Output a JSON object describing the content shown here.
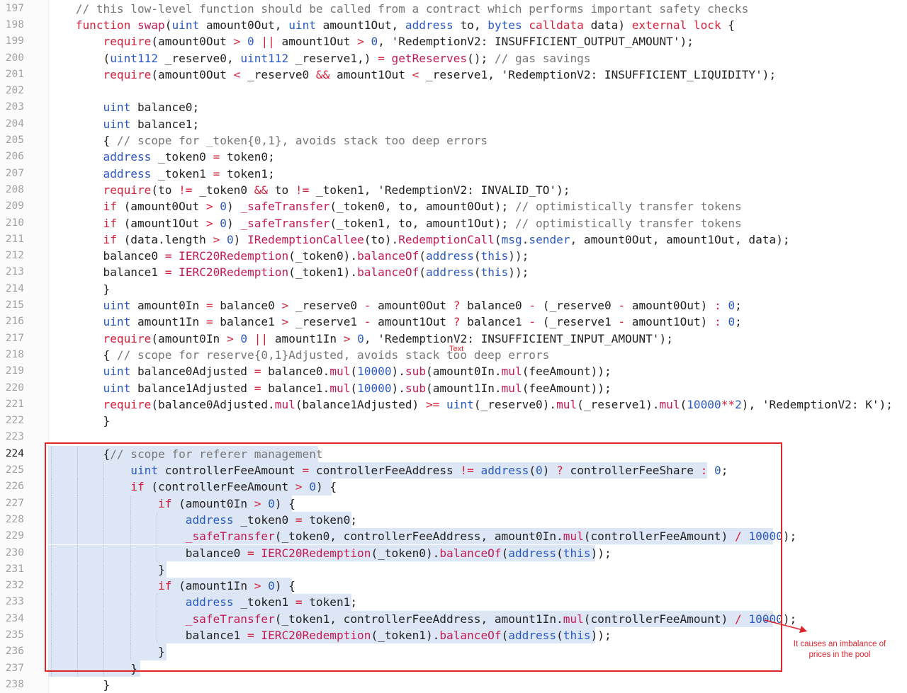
{
  "editor": {
    "lines": [
      {
        "n": "197",
        "t": "    // this low-level function should be called from a contract which performs important safety checks"
      },
      {
        "n": "198",
        "t": "    function swap(uint amount0Out, uint amount1Out, address to, bytes calldata data) external lock {"
      },
      {
        "n": "199",
        "t": "        require(amount0Out > 0 || amount1Out > 0, 'RedemptionV2: INSUFFICIENT_OUTPUT_AMOUNT');"
      },
      {
        "n": "200",
        "t": "        (uint112 _reserve0, uint112 _reserve1,) = getReserves(); // gas savings"
      },
      {
        "n": "201",
        "t": "        require(amount0Out < _reserve0 && amount1Out < _reserve1, 'RedemptionV2: INSUFFICIENT_LIQUIDITY');"
      },
      {
        "n": "202",
        "t": ""
      },
      {
        "n": "203",
        "t": "        uint balance0;"
      },
      {
        "n": "204",
        "t": "        uint balance1;"
      },
      {
        "n": "205",
        "t": "        { // scope for _token{0,1}, avoids stack too deep errors"
      },
      {
        "n": "206",
        "t": "        address _token0 = token0;"
      },
      {
        "n": "207",
        "t": "        address _token1 = token1;"
      },
      {
        "n": "208",
        "t": "        require(to != _token0 && to != _token1, 'RedemptionV2: INVALID_TO');"
      },
      {
        "n": "209",
        "t": "        if (amount0Out > 0) _safeTransfer(_token0, to, amount0Out); // optimistically transfer tokens"
      },
      {
        "n": "210",
        "t": "        if (amount1Out > 0) _safeTransfer(_token1, to, amount1Out); // optimistically transfer tokens"
      },
      {
        "n": "211",
        "t": "        if (data.length > 0) IRedemptionCallee(to).RedemptionCall(msg.sender, amount0Out, amount1Out, data);"
      },
      {
        "n": "212",
        "t": "        balance0 = IERC20Redemption(_token0).balanceOf(address(this));"
      },
      {
        "n": "213",
        "t": "        balance1 = IERC20Redemption(_token1).balanceOf(address(this));"
      },
      {
        "n": "214",
        "t": "        }"
      },
      {
        "n": "215",
        "t": "        uint amount0In = balance0 > _reserve0 - amount0Out ? balance0 - (_reserve0 - amount0Out) : 0;"
      },
      {
        "n": "216",
        "t": "        uint amount1In = balance1 > _reserve1 - amount1Out ? balance1 - (_reserve1 - amount1Out) : 0;"
      },
      {
        "n": "217",
        "t": "        require(amount0In > 0 || amount1In > 0, 'RedemptionV2: INSUFFICIENT_INPUT_AMOUNT');"
      },
      {
        "n": "218",
        "t": "        { // scope for reserve{0,1}Adjusted, avoids stack too deep errors"
      },
      {
        "n": "219",
        "t": "        uint balance0Adjusted = balance0.mul(10000).sub(amount0In.mul(feeAmount));"
      },
      {
        "n": "220",
        "t": "        uint balance1Adjusted = balance1.mul(10000).sub(amount1In.mul(feeAmount));"
      },
      {
        "n": "221",
        "t": "        require(balance0Adjusted.mul(balance1Adjusted) >= uint(_reserve0).mul(_reserve1).mul(10000**2), 'RedemptionV2: K');"
      },
      {
        "n": "222",
        "t": "        }"
      },
      {
        "n": "223",
        "t": ""
      },
      {
        "n": "224",
        "t": "        {// scope for referer management"
      },
      {
        "n": "225",
        "t": "            uint controllerFeeAmount = controllerFeeAddress != address(0) ? controllerFeeShare : 0;"
      },
      {
        "n": "226",
        "t": "            if (controllerFeeAmount > 0) {"
      },
      {
        "n": "227",
        "t": "                if (amount0In > 0) {"
      },
      {
        "n": "228",
        "t": "                    address _token0 = token0;"
      },
      {
        "n": "229",
        "t": "                    _safeTransfer(_token0, controllerFeeAddress, amount0In.mul(controllerFeeAmount) / 10000);"
      },
      {
        "n": "230",
        "t": "                    balance0 = IERC20Redemption(_token0).balanceOf(address(this));"
      },
      {
        "n": "231",
        "t": "                }"
      },
      {
        "n": "232",
        "t": "                if (amount1In > 0) {"
      },
      {
        "n": "233",
        "t": "                    address _token1 = token1;"
      },
      {
        "n": "234",
        "t": "                    _safeTransfer(_token1, controllerFeeAddress, amount1In.mul(controllerFeeAmount) / 10000);"
      },
      {
        "n": "235",
        "t": "                    balance1 = IERC20Redemption(_token1).balanceOf(address(this));"
      },
      {
        "n": "236",
        "t": "                }"
      },
      {
        "n": "237",
        "t": "            }"
      },
      {
        "n": "238",
        "t": "        }"
      }
    ],
    "active_line": "224",
    "selection": {
      "from": "224",
      "to": "237"
    }
  },
  "annotation": {
    "note": "It causes an imbalance of prices in the pool",
    "stray_text": "Text",
    "color": "#e0242c"
  },
  "colors": {
    "keyword": "#d4203a",
    "type": "#2a59c4",
    "comment": "#777777",
    "selection": "#dde6f5"
  }
}
